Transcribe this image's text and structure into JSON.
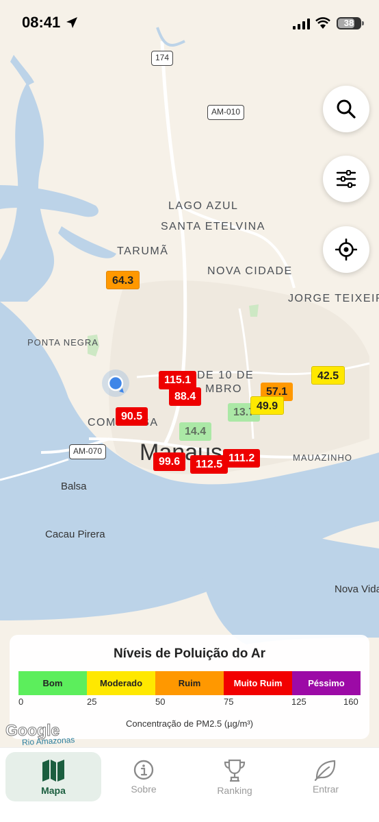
{
  "status_bar": {
    "time": "08:41",
    "battery": "38"
  },
  "map": {
    "areas": [
      "LAGO AZUL",
      "SANTA ETELVINA",
      "TARUMÃ",
      "NOVA CIDADE",
      "JORGE TEIXEIRA",
      "PONTA NEGRA",
      "DE 10 DE",
      "MBRO",
      "COMPENSA",
      "MAUAZINHO"
    ],
    "places": [
      "Balsa",
      "Cacau Pirera",
      "Nova Vida"
    ],
    "city": "Manaus",
    "roads": [
      "174",
      "AM-010",
      "AM-070"
    ],
    "river": "Rio Amazonas",
    "google_logo": "Google"
  },
  "markers": [
    {
      "value": "64.3",
      "level": "Ruim"
    },
    {
      "value": "115.1",
      "level": "Muito Ruim"
    },
    {
      "value": "88.4",
      "level": "Muito Ruim"
    },
    {
      "value": "90.5",
      "level": "Muito Ruim"
    },
    {
      "value": "14.4",
      "level": "Bom"
    },
    {
      "value": "13.7",
      "level": "Bom"
    },
    {
      "value": "57.1",
      "level": "Ruim"
    },
    {
      "value": "49.9",
      "level": "Moderado"
    },
    {
      "value": "42.5",
      "level": "Moderado"
    },
    {
      "value": "111.2",
      "level": "Muito Ruim"
    },
    {
      "value": "99.6",
      "level": "Muito Ruim"
    },
    {
      "value": "112.5",
      "level": "Muito Ruim"
    }
  ],
  "legend": {
    "title": "Níveis de Poluição do Ar",
    "levels": [
      {
        "label": "Bom",
        "color": "#5cee5c"
      },
      {
        "label": "Moderado",
        "color": "#ffe800"
      },
      {
        "label": "Ruim",
        "color": "#ff9800"
      },
      {
        "label": "Muito Ruim",
        "color": "#f20000"
      },
      {
        "label": "Péssimo",
        "color": "#9c0aa6"
      }
    ],
    "ticks": [
      "0",
      "25",
      "50",
      "75",
      "125",
      "160"
    ],
    "note": "Concentração de PM2.5 (µg/m³)"
  },
  "map_controls": {
    "icons": [
      "search-icon",
      "filter-sliders-icon",
      "my-location-icon"
    ]
  },
  "tabs": [
    {
      "label": "Mapa",
      "icon": "map-icon",
      "active": true
    },
    {
      "label": "Sobre",
      "icon": "info-icon",
      "active": false
    },
    {
      "label": "Ranking",
      "icon": "trophy-icon",
      "active": false
    },
    {
      "label": "Entrar",
      "icon": "leaf-icon",
      "active": false
    }
  ],
  "colors": {
    "accent": "#1b5e3f",
    "water": "#bcd3e8",
    "land": "#f6f1e8"
  }
}
